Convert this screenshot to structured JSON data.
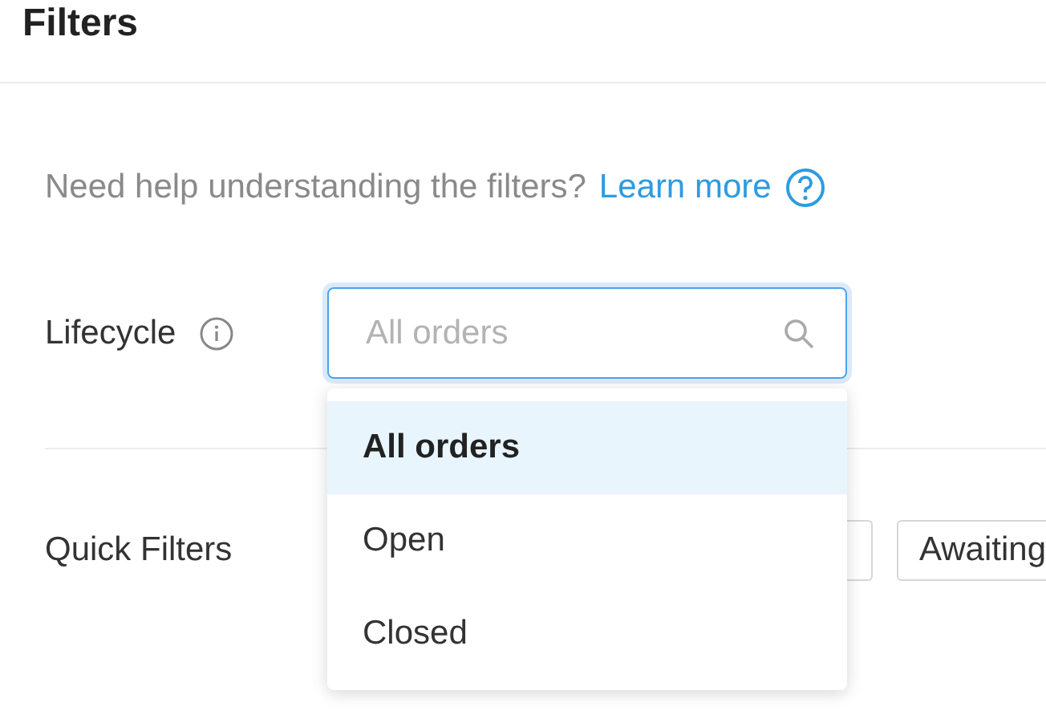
{
  "header": {
    "title": "Filters"
  },
  "help": {
    "text": "Need help understanding the filters?",
    "link": "Learn more"
  },
  "lifecycle": {
    "label": "Lifecycle",
    "placeholder": "All orders",
    "focused": true,
    "options": [
      {
        "label": "All orders",
        "selected": true
      },
      {
        "label": "Open",
        "selected": false
      },
      {
        "label": "Closed",
        "selected": false
      }
    ]
  },
  "quick_filters": {
    "label": "Quick Filters",
    "chips": [
      {
        "kind": "covered"
      },
      {
        "kind": "label",
        "label": "Awaiting"
      }
    ]
  }
}
